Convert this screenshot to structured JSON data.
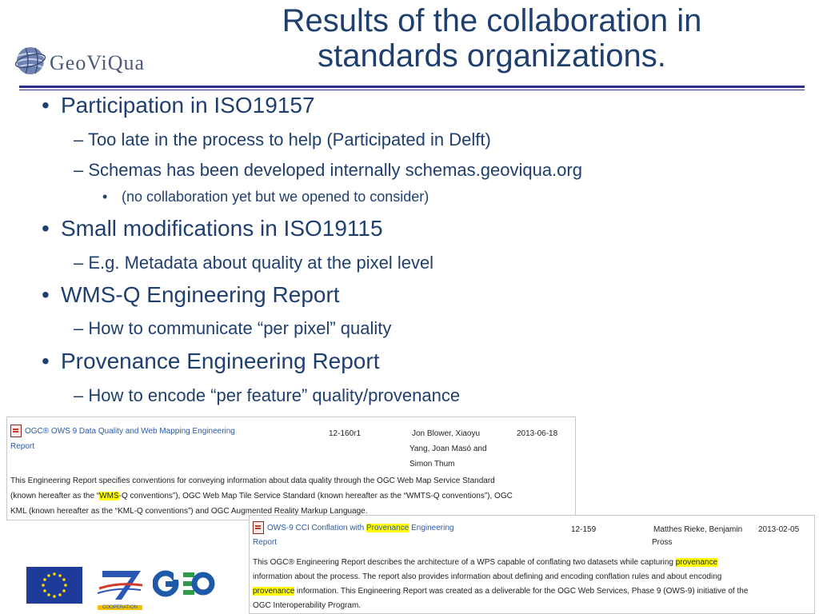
{
  "slide": {
    "title_line1": "Results of the collaboration in",
    "title_line2": "standards organizations.",
    "logo_text": "GeoViQua"
  },
  "bullets": [
    {
      "level": 1,
      "text": "Participation in ISO19157"
    },
    {
      "level": 2,
      "text": "– Too late in the process to help (Participated in Delft)"
    },
    {
      "level": 2,
      "text": "– Schemas has been developed internally schemas.geoviqua.org"
    },
    {
      "level": 3,
      "text": "(no collaboration yet but we opened to consider)"
    },
    {
      "level": 1,
      "text": "Small modifications in ISO19115"
    },
    {
      "level": 2,
      "text": "– E.g. Metadata about quality at the pixel level"
    },
    {
      "level": 1,
      "text": "WMS-Q Engineering Report"
    },
    {
      "level": 2,
      "text": "– How to communicate “per pixel” quality"
    },
    {
      "level": 1,
      "text": "Provenance Engineering Report"
    },
    {
      "level": 2,
      "text": "– How to encode “per feature” quality/provenance"
    }
  ],
  "bullet_marker": "•",
  "report1": {
    "title_a": "OGC® OWS 9 Data Quality and Web Mapping Engineering",
    "title_b": "Report",
    "number": "12-160r1",
    "authors_1": "Jon Blower, Xiaoyu",
    "authors_2": "Yang, Joan Masó and",
    "authors_3": "Simon Thum",
    "date": "2013-06-18",
    "desc_1": "This Engineering Report specifies conventions for conveying information about data quality through the OGC Web Map Service Standard",
    "desc_2a": "(known hereafter as the “",
    "desc_2hl": "WMS",
    "desc_2b": "-Q conventions”), OGC Web Map Tile Service Standard (known hereafter as the “WMTS-Q conventions”), OGC",
    "desc_3": "KML (known hereafter as the “KML-Q conventions”) and OGC Augmented Reality Markup Language."
  },
  "report2": {
    "title_a": "OWS-9 CCI Conflation with ",
    "title_hl": "Provenance",
    "title_c": " Engineering",
    "title_b": "Report",
    "number": "12-159",
    "authors_1": "Matthes Rieke, Benjamin",
    "authors_2": "Pross",
    "date": "2013-02-05",
    "desc_1a": "This OGC® Engineering Report describes the architecture of a WPS capable of conflating two datasets while capturing ",
    "desc_1hl": "provenance",
    "desc_2": "information about the process. The report also provides information about defining and encoding conflation rules and about encoding",
    "desc_3hl": "provenance",
    "desc_3b": " information. This Engineering Report was created as a deliverable for the OGC Web Services, Phase 9 (OWS-9) initiative of the",
    "desc_4": "OGC Interoperability Program."
  },
  "footer_logos": {
    "fp7_caption": "COOPERATION"
  },
  "colors": {
    "title": "#1f3f6e",
    "rule": "#2e2e8f",
    "link": "#2a5aa8",
    "highlight": "#ffff00",
    "eu_blue": "#1e3b9a",
    "eu_star": "#ffdd00"
  }
}
